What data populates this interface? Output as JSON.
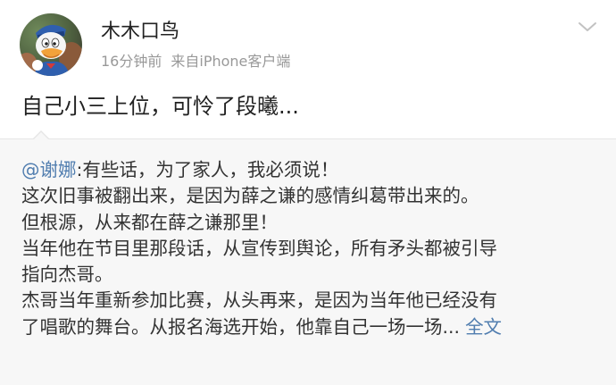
{
  "post": {
    "author": {
      "name": "木木口鸟"
    },
    "time": "16分钟前",
    "source": "来自iPhone客户端",
    "text": "自己小三上位，可怜了段曦..."
  },
  "repost": {
    "mention": "@谢娜",
    "lines": [
      ":有些话，为了家人，我必须说！",
      "这次旧事被翻出来，是因为薛之谦的感情纠葛带出来的。",
      "但根源，从来都在薛之谦那里！",
      "当年他在节目里那段话，从宣传到舆论，所有矛头都被引导",
      "指向杰哥。",
      "杰哥当年重新参加比赛，从头再来，是因为当年他已经没有",
      "了唱歌的舞台。从报名海选开始，他靠自己一场一场..."
    ],
    "full_text_link": "全文"
  },
  "icons": {
    "chevron": "chevron-down-icon",
    "avatar": "donald-duck-avatar"
  },
  "colors": {
    "link": "#507daf",
    "meta": "#999999",
    "repost_background": "#f7f7f7"
  }
}
